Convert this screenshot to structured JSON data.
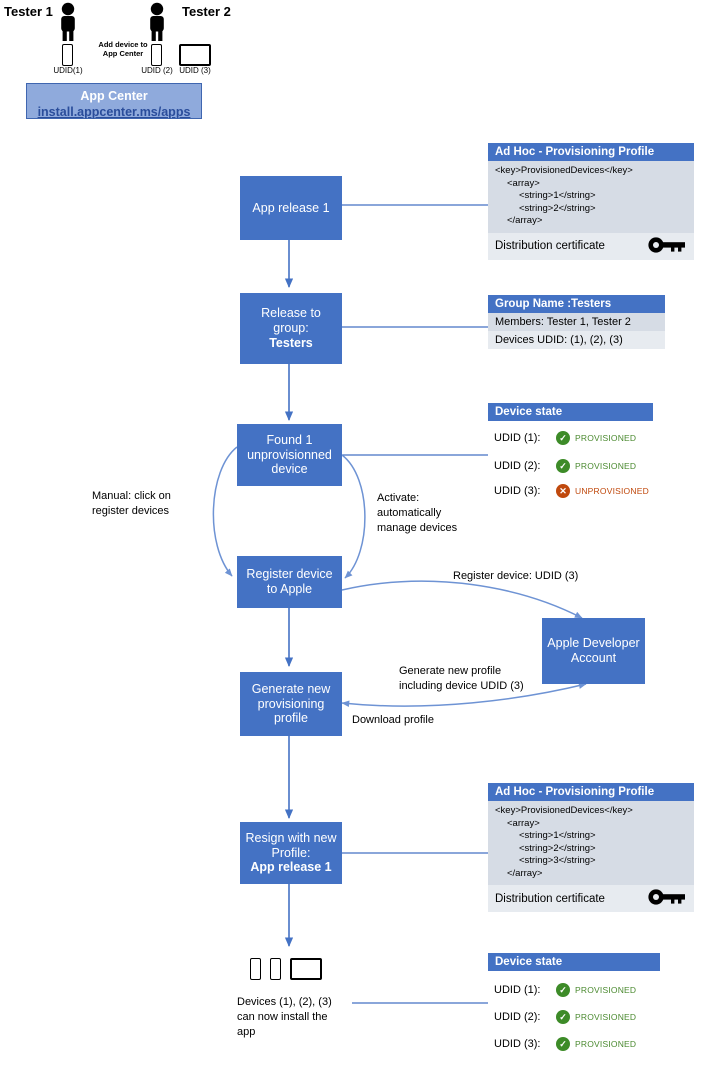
{
  "testers": {
    "tester1_label": "Tester 1",
    "tester2_label": "Tester 2",
    "add_device_note_line1": "Add device to",
    "add_device_note_line2": "App Center",
    "udid1": "UDID(1)",
    "udid2": "UDID (2)",
    "udid3": "UDID (3)"
  },
  "appcenter": {
    "title": "App Center",
    "link": "install.appcenter.ms/apps"
  },
  "flow": {
    "app_release": "App release 1",
    "release_group_l1": "Release to",
    "release_group_l2": "group:",
    "release_group_l3": "Testers",
    "found_l1": "Found 1",
    "found_l2": "unprovisionned",
    "found_l3": "device",
    "register_l1": "Register device",
    "register_l2": "to Apple",
    "generate_l1": "Generate new",
    "generate_l2": "provisioning",
    "generate_l3": "profile",
    "resign_l1": "Resign with new",
    "resign_l2": "Profile:",
    "resign_l3": "App release 1",
    "apple_account_l1": "Apple Developer",
    "apple_account_l2": "Account"
  },
  "annotations": {
    "manual_l1": "Manual: click on",
    "manual_l2": "register devices",
    "activate_l1": "Activate:",
    "activate_l2": "automatically",
    "activate_l3": "manage devices",
    "register_device_udid": "Register device: UDID (3)",
    "generate_profile_l1": "Generate new profile",
    "generate_profile_l2": "including device UDID (3)",
    "download_profile": "Download profile",
    "devices_install_l1": "Devices (1), (2), (3)",
    "devices_install_l2": "can now install the",
    "devices_install_l3": "app"
  },
  "profile_card_top": {
    "header": "Ad Hoc - Provisioning Profile",
    "plist_lines": [
      {
        "text": "<key>ProvisionedDevices</key>",
        "indent": 0
      },
      {
        "text": "<array>",
        "indent": 1
      },
      {
        "text": "<string>1</string>",
        "indent": 2
      },
      {
        "text": "<string>2</string>",
        "indent": 2
      },
      {
        "text": "</array>",
        "indent": 1
      }
    ],
    "cert_label": "Distribution certificate",
    "cert_icon": "key-icon"
  },
  "group_card": {
    "header": "Group Name :Testers",
    "members_row": "Members: Tester 1, Tester 2",
    "devices_row": "Devices UDID: (1), (2), (3)"
  },
  "device_state_top": {
    "header": "Device state",
    "rows": [
      {
        "udid": "UDID (1):",
        "status": "PROVISIONED",
        "state": "ok"
      },
      {
        "udid": "UDID (2):",
        "status": "PROVISIONED",
        "state": "ok"
      },
      {
        "udid": "UDID (3):",
        "status": "UNPROVISIONED",
        "state": "bad"
      }
    ]
  },
  "profile_card_bottom": {
    "header": "Ad Hoc - Provisioning Profile",
    "plist_lines": [
      {
        "text": "<key>ProvisionedDevices</key>",
        "indent": 0
      },
      {
        "text": "<array>",
        "indent": 1
      },
      {
        "text": "<string>1</string>",
        "indent": 2
      },
      {
        "text": "<string>2</string>",
        "indent": 2
      },
      {
        "text": "<string>3</string>",
        "indent": 2
      },
      {
        "text": "</array>",
        "indent": 1
      }
    ],
    "cert_label": "Distribution certificate",
    "cert_icon": "key-icon"
  },
  "device_state_bottom": {
    "header": "Device state",
    "rows": [
      {
        "udid": "UDID (1):",
        "status": "PROVISIONED",
        "state": "ok"
      },
      {
        "udid": "UDID (2):",
        "status": "PROVISIONED",
        "state": "ok"
      },
      {
        "udid": "UDID (3):",
        "status": "PROVISIONED",
        "state": "ok"
      }
    ]
  },
  "colors": {
    "process_blue": "#4472C4",
    "light_blue": "#8FAADC",
    "card_body": "#D6DCE5",
    "card_row_alt": "#E7EBF0",
    "ok_green": "#3D8B28",
    "bad_orange": "#C0490D",
    "link_blue": "#2A4D9B"
  }
}
